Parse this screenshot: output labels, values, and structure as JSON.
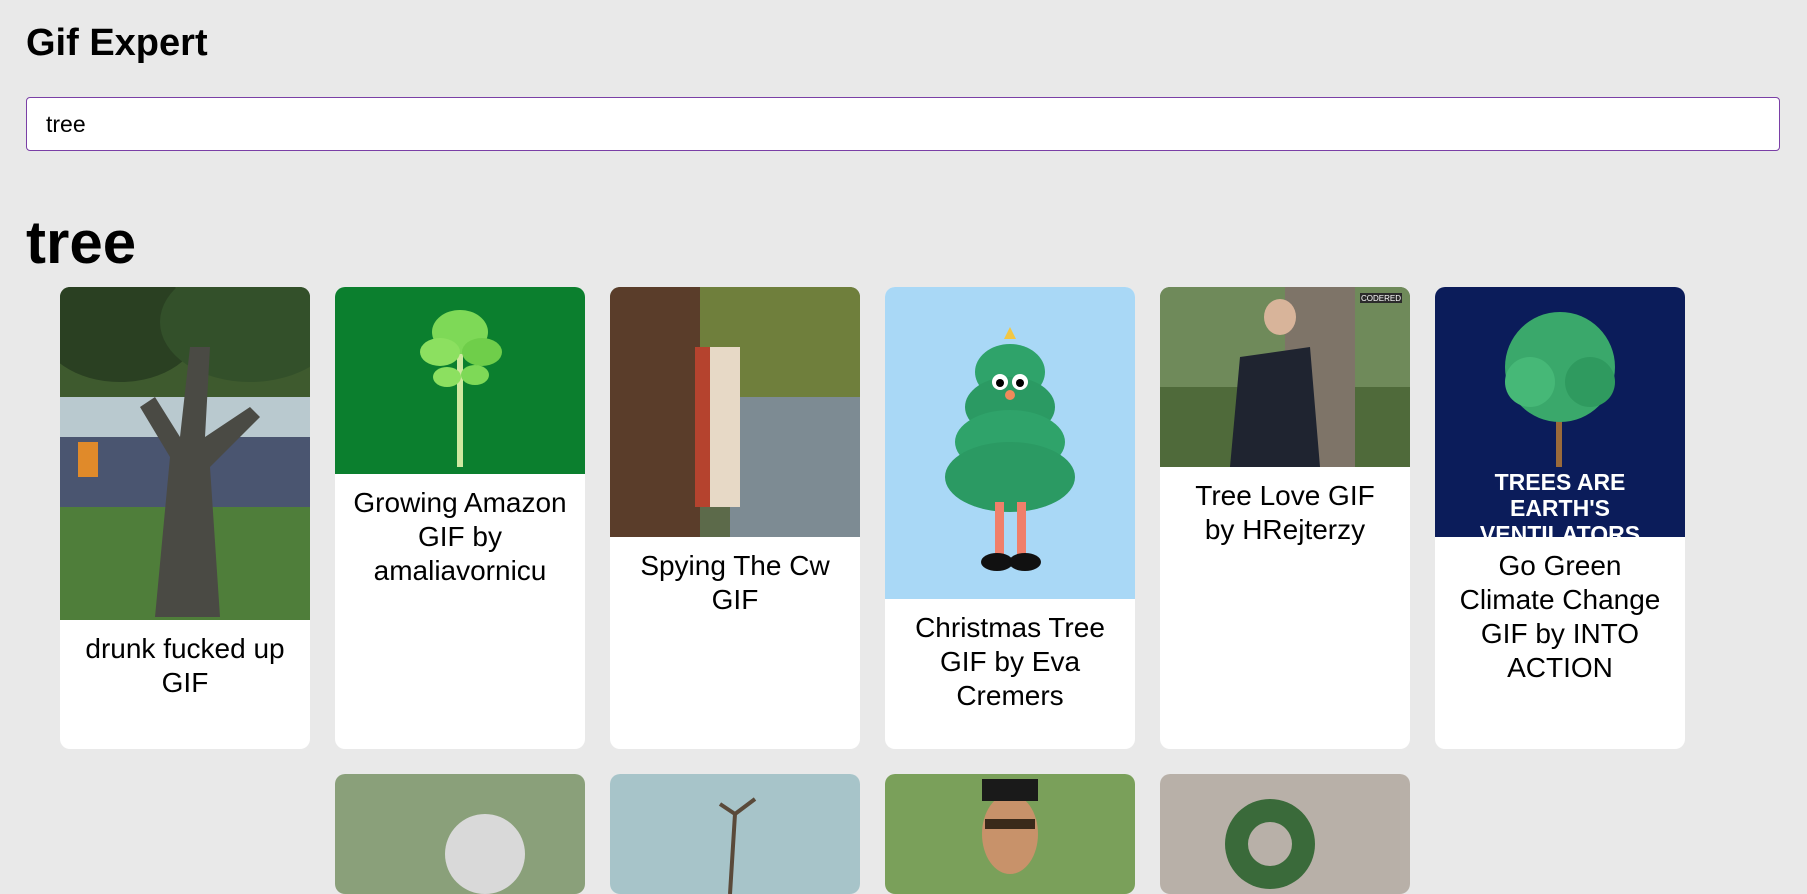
{
  "app": {
    "title": "Gif Expert"
  },
  "search": {
    "value": "tree"
  },
  "category": {
    "title": "tree"
  },
  "gifs": [
    {
      "title": "drunk fucked up GIF"
    },
    {
      "title": "Growing Amazon GIF by amaliavornicu"
    },
    {
      "title": "Spying The Cw GIF"
    },
    {
      "title": "Christmas Tree GIF by Eva Cremers"
    },
    {
      "title": "Tree Love GIF by HRejterzy",
      "watermark": "CODERED"
    },
    {
      "title": "Go Green Climate Change GIF by INTO ACTION",
      "image_text": "TREES ARE EARTH'S VENTILATORS"
    }
  ],
  "colors": {
    "background": "#e9e9e9",
    "card": "#ffffff",
    "search_border": "#7a3fa6",
    "green_tile": "#0b7f2e",
    "navy_tile": "#0b1c5a",
    "sky_tile": "#a9d8f6"
  }
}
